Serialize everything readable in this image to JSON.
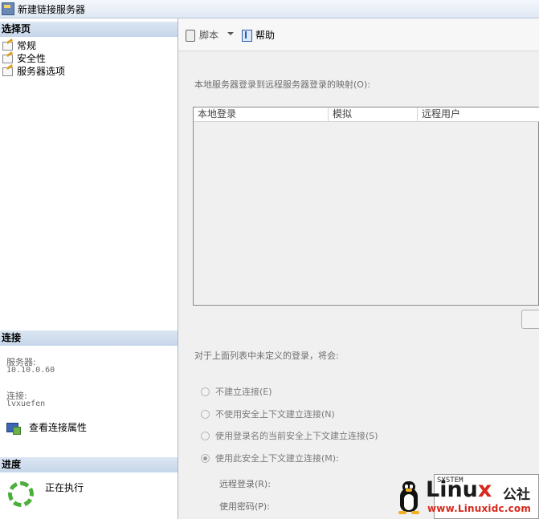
{
  "window": {
    "title": "新建链接服务器"
  },
  "left_panel": {
    "select_page": {
      "header": "选择页",
      "items": [
        {
          "label": "常规"
        },
        {
          "label": "安全性"
        },
        {
          "label": "服务器选项"
        }
      ]
    },
    "connection": {
      "header": "连接",
      "server_label": "服务器:",
      "server_value": "10.10.0.60",
      "conn_label": "连接:",
      "conn_value": "lvxuefen",
      "view_props_link": "查看连接属性"
    },
    "progress": {
      "header": "进度",
      "status": "正在执行"
    }
  },
  "toolbar": {
    "script_label": "脚本",
    "help_label": "帮助"
  },
  "main": {
    "mapping_label": "本地服务器登录到远程服务器登录的映射(O):",
    "table": {
      "columns": [
        "本地登录",
        "模拟",
        "远程用户"
      ],
      "rows": []
    },
    "undefined_login_label": "对于上面列表中未定义的登录，将会:",
    "radio_options": [
      {
        "label": "不建立连接(E)",
        "checked": false
      },
      {
        "label": "不使用安全上下文建立连接(N)",
        "checked": false
      },
      {
        "label": "使用登录名的当前安全上下文建立连接(S)",
        "checked": false
      },
      {
        "label": "使用此安全上下文建立连接(M):",
        "checked": true
      }
    ],
    "remote_login_label": "远程登录(R):",
    "password_label": "使用密码(P):",
    "remote_login_value": "SYSTEM"
  },
  "watermark": {
    "brand_main": "Linu",
    "brand_x": "x",
    "brand_suffix": "公社",
    "url": "www.Linuxidc.com"
  }
}
